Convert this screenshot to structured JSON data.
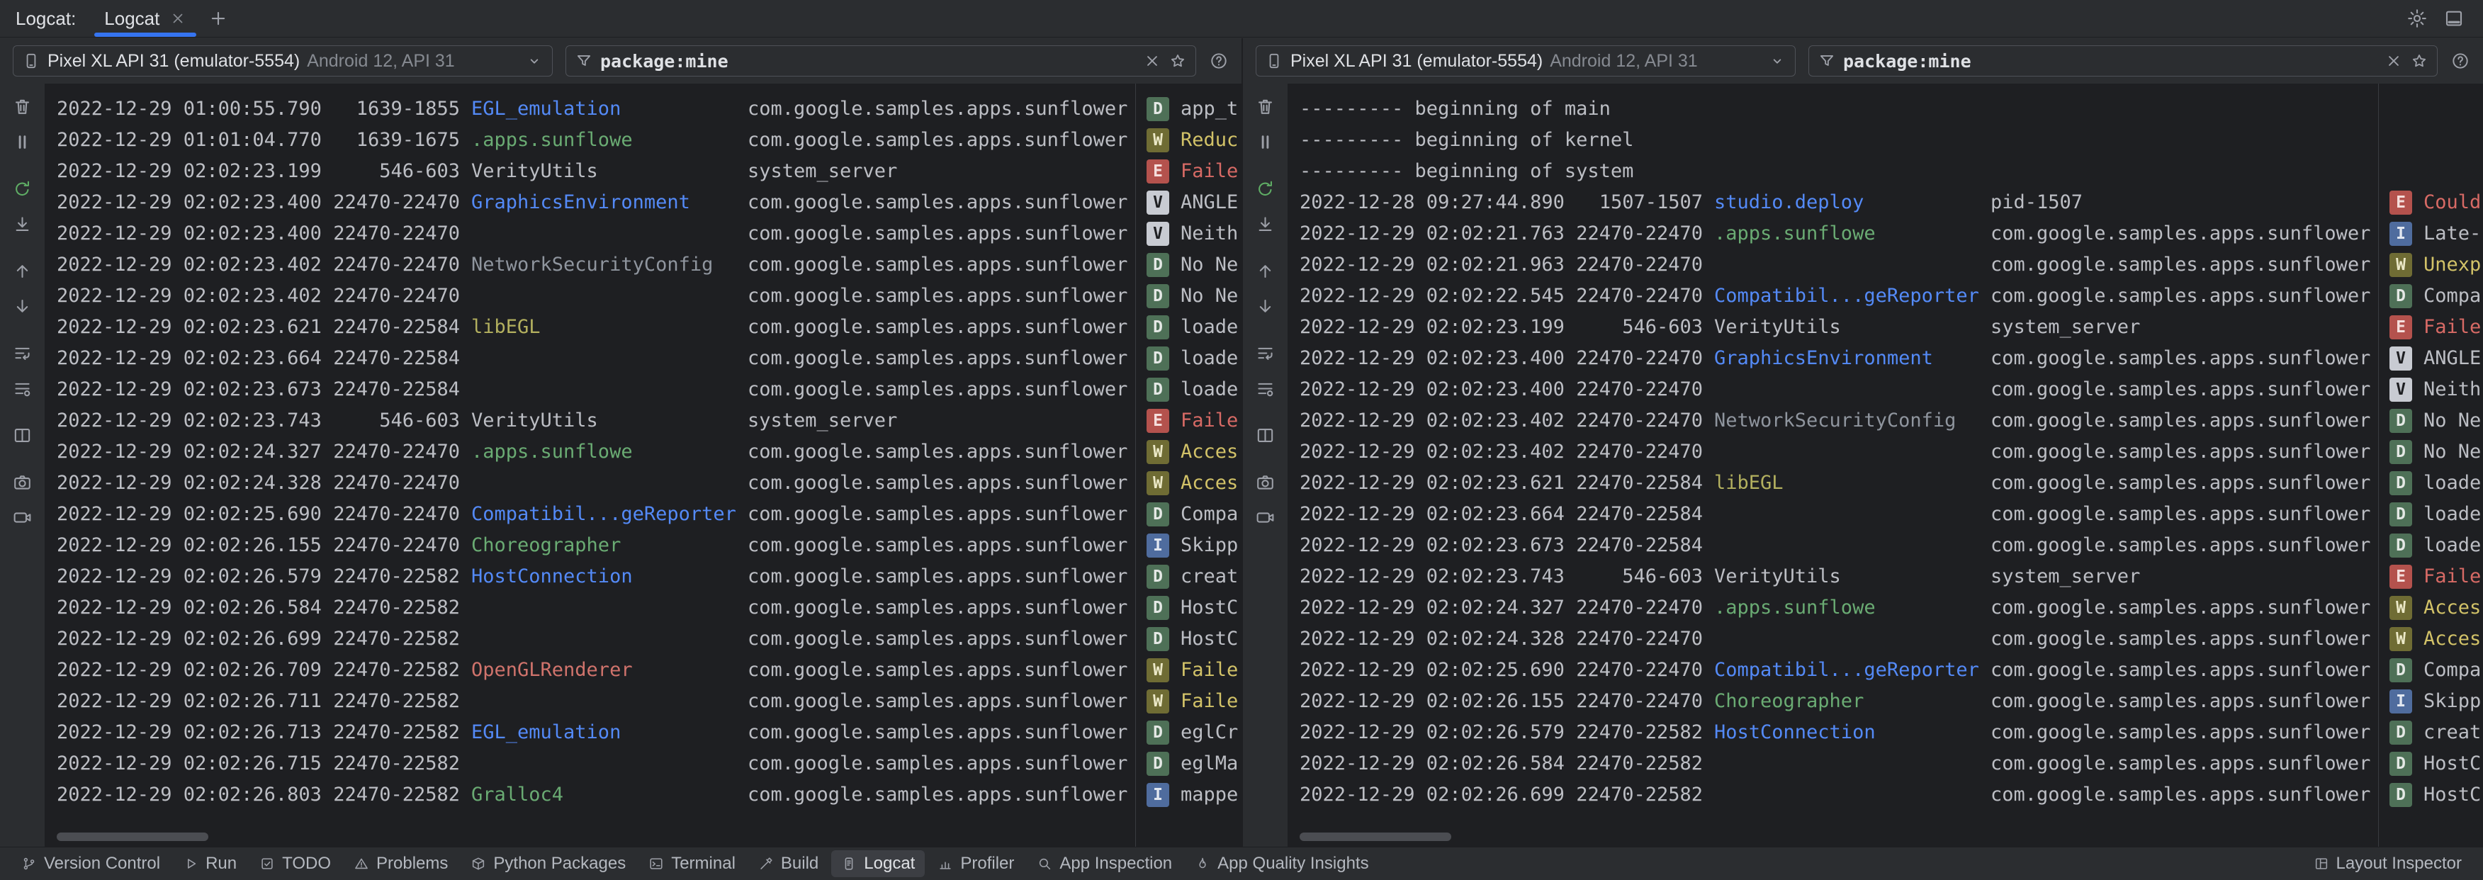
{
  "colors": {
    "accent": "#3574F0",
    "window_bg": "#2B2D30",
    "log_bg": "#1E1F22",
    "column_divider": "#393B40",
    "log_text": "#BCBEC4",
    "restart_green": "#5FAD65"
  },
  "tab_bar": {
    "group_label": "Logcat:",
    "tabs": [
      {
        "label": "Logcat",
        "active": true,
        "close_icon": "close-icon"
      }
    ],
    "add_icon": "plus-icon",
    "actions": [
      {
        "icon": "gear-icon",
        "name": "settings-button"
      },
      {
        "icon": "hide-icon",
        "name": "hide-toolwindow-button"
      }
    ]
  },
  "toolbar_icons": [
    {
      "icon": "trash-icon",
      "name": "clear-logcat-button"
    },
    {
      "icon": "pause-icon",
      "name": "pause-logcat-button"
    },
    {
      "icon": "restart-icon",
      "name": "restart-logcat-button",
      "color": "#5FAD65",
      "gap": true
    },
    {
      "icon": "scroll-end-icon",
      "name": "scroll-to-end-button"
    },
    {
      "icon": "arrow-up-icon",
      "name": "previous-message-button",
      "gap": true
    },
    {
      "icon": "arrow-down-icon",
      "name": "next-message-button"
    },
    {
      "icon": "soft-wrap-icon",
      "name": "soft-wrap-button",
      "gap": true
    },
    {
      "icon": "format-icon",
      "name": "formatting-options-button"
    },
    {
      "icon": "split-icon",
      "name": "split-panels-button",
      "gap": true
    },
    {
      "icon": "camera-icon",
      "name": "take-screenshot-button",
      "gap": true
    },
    {
      "icon": "record-icon",
      "name": "record-screen-button"
    }
  ],
  "levels": {
    "V": {
      "bg": "#C8CBD2",
      "fg": "#1E1F22",
      "msg": "#BCBEC4"
    },
    "D": {
      "bg": "#4E7057",
      "fg": "#E4E8E5",
      "msg": "#BCBEC4"
    },
    "I": {
      "bg": "#4F6C9E",
      "fg": "#E2E7F0",
      "msg": "#BCBEC4"
    },
    "W": {
      "bg": "#6F6C34",
      "fg": "#ECE9C8",
      "msg": "#D2C268"
    },
    "E": {
      "bg": "#B4524D",
      "fg": "#F5DEDC",
      "msg": "#D76A65"
    }
  },
  "tag_colors": {
    "EGL_emulation": "#548AF7",
    ".apps.sunflowe": "#6AAB73",
    "VerityUtils": "#BCBEC4",
    "GraphicsEnvironment": "#548AF7",
    "NetworkSecurityConfig": "#8F959E",
    "libEGL": "#B3B05F",
    "Compatibil...geReporter": "#548AF7",
    "Choreographer": "#6AAB73",
    "HostConnection": "#548AF7",
    "OpenGLRenderer": "#D0736C",
    "Gralloc4": "#6AAB73",
    "studio.deploy": "#548AF7"
  },
  "panes": [
    {
      "device": {
        "name": "Pixel XL API 31 (emulator-5554)",
        "details": "Android 12, API 31"
      },
      "filter": {
        "value": "package:mine"
      },
      "rows": [
        {
          "t": "2022-12-29 01:00:55.790",
          "p": "1639-1855",
          "g": "EGL_emulation",
          "k": "com.google.samples.apps.sunflower",
          "l": "D",
          "m": "app_t"
        },
        {
          "t": "2022-12-29 01:01:04.770",
          "p": "1639-1675",
          "g": ".apps.sunflowe",
          "k": "com.google.samples.apps.sunflower",
          "l": "W",
          "m": "Reduc"
        },
        {
          "t": "2022-12-29 02:02:23.199",
          "p": "546-603",
          "g": "VerityUtils",
          "k": "system_server",
          "l": "E",
          "m": "Faile"
        },
        {
          "t": "2022-12-29 02:02:23.400",
          "p": "22470-22470",
          "g": "GraphicsEnvironment",
          "k": "com.google.samples.apps.sunflower",
          "l": "V",
          "m": "ANGLE"
        },
        {
          "t": "2022-12-29 02:02:23.400",
          "p": "22470-22470",
          "g": "",
          "k": "com.google.samples.apps.sunflower",
          "l": "V",
          "m": "Neith"
        },
        {
          "t": "2022-12-29 02:02:23.402",
          "p": "22470-22470",
          "g": "NetworkSecurityConfig",
          "k": "com.google.samples.apps.sunflower",
          "l": "D",
          "m": "No Ne"
        },
        {
          "t": "2022-12-29 02:02:23.402",
          "p": "22470-22470",
          "g": "",
          "k": "com.google.samples.apps.sunflower",
          "l": "D",
          "m": "No Ne"
        },
        {
          "t": "2022-12-29 02:02:23.621",
          "p": "22470-22584",
          "g": "libEGL",
          "k": "com.google.samples.apps.sunflower",
          "l": "D",
          "m": "loade"
        },
        {
          "t": "2022-12-29 02:02:23.664",
          "p": "22470-22584",
          "g": "",
          "k": "com.google.samples.apps.sunflower",
          "l": "D",
          "m": "loade"
        },
        {
          "t": "2022-12-29 02:02:23.673",
          "p": "22470-22584",
          "g": "",
          "k": "com.google.samples.apps.sunflower",
          "l": "D",
          "m": "loade"
        },
        {
          "t": "2022-12-29 02:02:23.743",
          "p": "546-603",
          "g": "VerityUtils",
          "k": "system_server",
          "l": "E",
          "m": "Faile"
        },
        {
          "t": "2022-12-29 02:02:24.327",
          "p": "22470-22470",
          "g": ".apps.sunflowe",
          "k": "com.google.samples.apps.sunflower",
          "l": "W",
          "m": "Acces"
        },
        {
          "t": "2022-12-29 02:02:24.328",
          "p": "22470-22470",
          "g": "",
          "k": "com.google.samples.apps.sunflower",
          "l": "W",
          "m": "Acces"
        },
        {
          "t": "2022-12-29 02:02:25.690",
          "p": "22470-22470",
          "g": "Compatibil...geReporter",
          "k": "com.google.samples.apps.sunflower",
          "l": "D",
          "m": "Compa"
        },
        {
          "t": "2022-12-29 02:02:26.155",
          "p": "22470-22470",
          "g": "Choreographer",
          "k": "com.google.samples.apps.sunflower",
          "l": "I",
          "m": "Skipp"
        },
        {
          "t": "2022-12-29 02:02:26.579",
          "p": "22470-22582",
          "g": "HostConnection",
          "k": "com.google.samples.apps.sunflower",
          "l": "D",
          "m": "creat"
        },
        {
          "t": "2022-12-29 02:02:26.584",
          "p": "22470-22582",
          "g": "",
          "k": "com.google.samples.apps.sunflower",
          "l": "D",
          "m": "HostC"
        },
        {
          "t": "2022-12-29 02:02:26.699",
          "p": "22470-22582",
          "g": "",
          "k": "com.google.samples.apps.sunflower",
          "l": "D",
          "m": "HostC"
        },
        {
          "t": "2022-12-29 02:02:26.709",
          "p": "22470-22582",
          "g": "OpenGLRenderer",
          "k": "com.google.samples.apps.sunflower",
          "l": "W",
          "m": "Faile"
        },
        {
          "t": "2022-12-29 02:02:26.711",
          "p": "22470-22582",
          "g": "",
          "k": "com.google.samples.apps.sunflower",
          "l": "W",
          "m": "Faile"
        },
        {
          "t": "2022-12-29 02:02:26.713",
          "p": "22470-22582",
          "g": "EGL_emulation",
          "k": "com.google.samples.apps.sunflower",
          "l": "D",
          "m": "eglCr"
        },
        {
          "t": "2022-12-29 02:02:26.715",
          "p": "22470-22582",
          "g": "",
          "k": "com.google.samples.apps.sunflower",
          "l": "D",
          "m": "eglMa"
        },
        {
          "t": "2022-12-29 02:02:26.803",
          "p": "22470-22582",
          "g": "Gralloc4",
          "k": "com.google.samples.apps.sunflower",
          "l": "I",
          "m": "mappe"
        }
      ]
    },
    {
      "device": {
        "name": "Pixel XL API 31 (emulator-5554)",
        "details": "Android 12, API 31"
      },
      "filter": {
        "value": "package:mine"
      },
      "rows": [
        {
          "b": "--------- beginning of main"
        },
        {
          "b": "--------- beginning of kernel"
        },
        {
          "b": "--------- beginning of system"
        },
        {
          "t": "2022-12-28 09:27:44.890",
          "p": "1507-1507",
          "g": "studio.deploy",
          "k": "pid-1507",
          "l": "E",
          "m": "Could"
        },
        {
          "t": "2022-12-29 02:02:21.763",
          "p": "22470-22470",
          "g": ".apps.sunflowe",
          "k": "com.google.samples.apps.sunflower",
          "l": "I",
          "m": "Late-"
        },
        {
          "t": "2022-12-29 02:02:21.963",
          "p": "22470-22470",
          "g": "",
          "k": "com.google.samples.apps.sunflower",
          "l": "W",
          "m": "Unexp"
        },
        {
          "t": "2022-12-29 02:02:22.545",
          "p": "22470-22470",
          "g": "Compatibil...geReporter",
          "k": "com.google.samples.apps.sunflower",
          "l": "D",
          "m": "Compa"
        },
        {
          "t": "2022-12-29 02:02:23.199",
          "p": "546-603",
          "g": "VerityUtils",
          "k": "system_server",
          "l": "E",
          "m": "Faile"
        },
        {
          "t": "2022-12-29 02:02:23.400",
          "p": "22470-22470",
          "g": "GraphicsEnvironment",
          "k": "com.google.samples.apps.sunflower",
          "l": "V",
          "m": "ANGLE"
        },
        {
          "t": "2022-12-29 02:02:23.400",
          "p": "22470-22470",
          "g": "",
          "k": "com.google.samples.apps.sunflower",
          "l": "V",
          "m": "Neith"
        },
        {
          "t": "2022-12-29 02:02:23.402",
          "p": "22470-22470",
          "g": "NetworkSecurityConfig",
          "k": "com.google.samples.apps.sunflower",
          "l": "D",
          "m": "No Ne"
        },
        {
          "t": "2022-12-29 02:02:23.402",
          "p": "22470-22470",
          "g": "",
          "k": "com.google.samples.apps.sunflower",
          "l": "D",
          "m": "No Ne"
        },
        {
          "t": "2022-12-29 02:02:23.621",
          "p": "22470-22584",
          "g": "libEGL",
          "k": "com.google.samples.apps.sunflower",
          "l": "D",
          "m": "loade"
        },
        {
          "t": "2022-12-29 02:02:23.664",
          "p": "22470-22584",
          "g": "",
          "k": "com.google.samples.apps.sunflower",
          "l": "D",
          "m": "loade"
        },
        {
          "t": "2022-12-29 02:02:23.673",
          "p": "22470-22584",
          "g": "",
          "k": "com.google.samples.apps.sunflower",
          "l": "D",
          "m": "loade"
        },
        {
          "t": "2022-12-29 02:02:23.743",
          "p": "546-603",
          "g": "VerityUtils",
          "k": "system_server",
          "l": "E",
          "m": "Faile"
        },
        {
          "t": "2022-12-29 02:02:24.327",
          "p": "22470-22470",
          "g": ".apps.sunflowe",
          "k": "com.google.samples.apps.sunflower",
          "l": "W",
          "m": "Acces"
        },
        {
          "t": "2022-12-29 02:02:24.328",
          "p": "22470-22470",
          "g": "",
          "k": "com.google.samples.apps.sunflower",
          "l": "W",
          "m": "Acces"
        },
        {
          "t": "2022-12-29 02:02:25.690",
          "p": "22470-22470",
          "g": "Compatibil...geReporter",
          "k": "com.google.samples.apps.sunflower",
          "l": "D",
          "m": "Compa"
        },
        {
          "t": "2022-12-29 02:02:26.155",
          "p": "22470-22470",
          "g": "Choreographer",
          "k": "com.google.samples.apps.sunflower",
          "l": "I",
          "m": "Skipp"
        },
        {
          "t": "2022-12-29 02:02:26.579",
          "p": "22470-22582",
          "g": "HostConnection",
          "k": "com.google.samples.apps.sunflower",
          "l": "D",
          "m": "creat"
        },
        {
          "t": "2022-12-29 02:02:26.584",
          "p": "22470-22582",
          "g": "",
          "k": "com.google.samples.apps.sunflower",
          "l": "D",
          "m": "HostC"
        },
        {
          "t": "2022-12-29 02:02:26.699",
          "p": "22470-22582",
          "g": "",
          "k": "com.google.samples.apps.sunflower",
          "l": "D",
          "m": "HostC"
        }
      ]
    }
  ],
  "status_bar": {
    "left": [
      {
        "label": "Version Control",
        "icon": "branch-icon"
      },
      {
        "label": "Run",
        "icon": "play-icon"
      },
      {
        "label": "TODO",
        "icon": "todo-icon"
      },
      {
        "label": "Problems",
        "icon": "problems-icon"
      },
      {
        "label": "Python Packages",
        "icon": "package-icon"
      },
      {
        "label": "Terminal",
        "icon": "terminal-icon"
      },
      {
        "label": "Build",
        "icon": "build-icon"
      },
      {
        "label": "Logcat",
        "icon": "logcat-icon",
        "active": true
      },
      {
        "label": "Profiler",
        "icon": "profiler-icon"
      },
      {
        "label": "App Inspection",
        "icon": "inspection-icon"
      },
      {
        "label": "App Quality Insights",
        "icon": "insights-icon"
      }
    ],
    "right": [
      {
        "label": "Layout Inspector",
        "icon": "layout-icon"
      }
    ]
  }
}
